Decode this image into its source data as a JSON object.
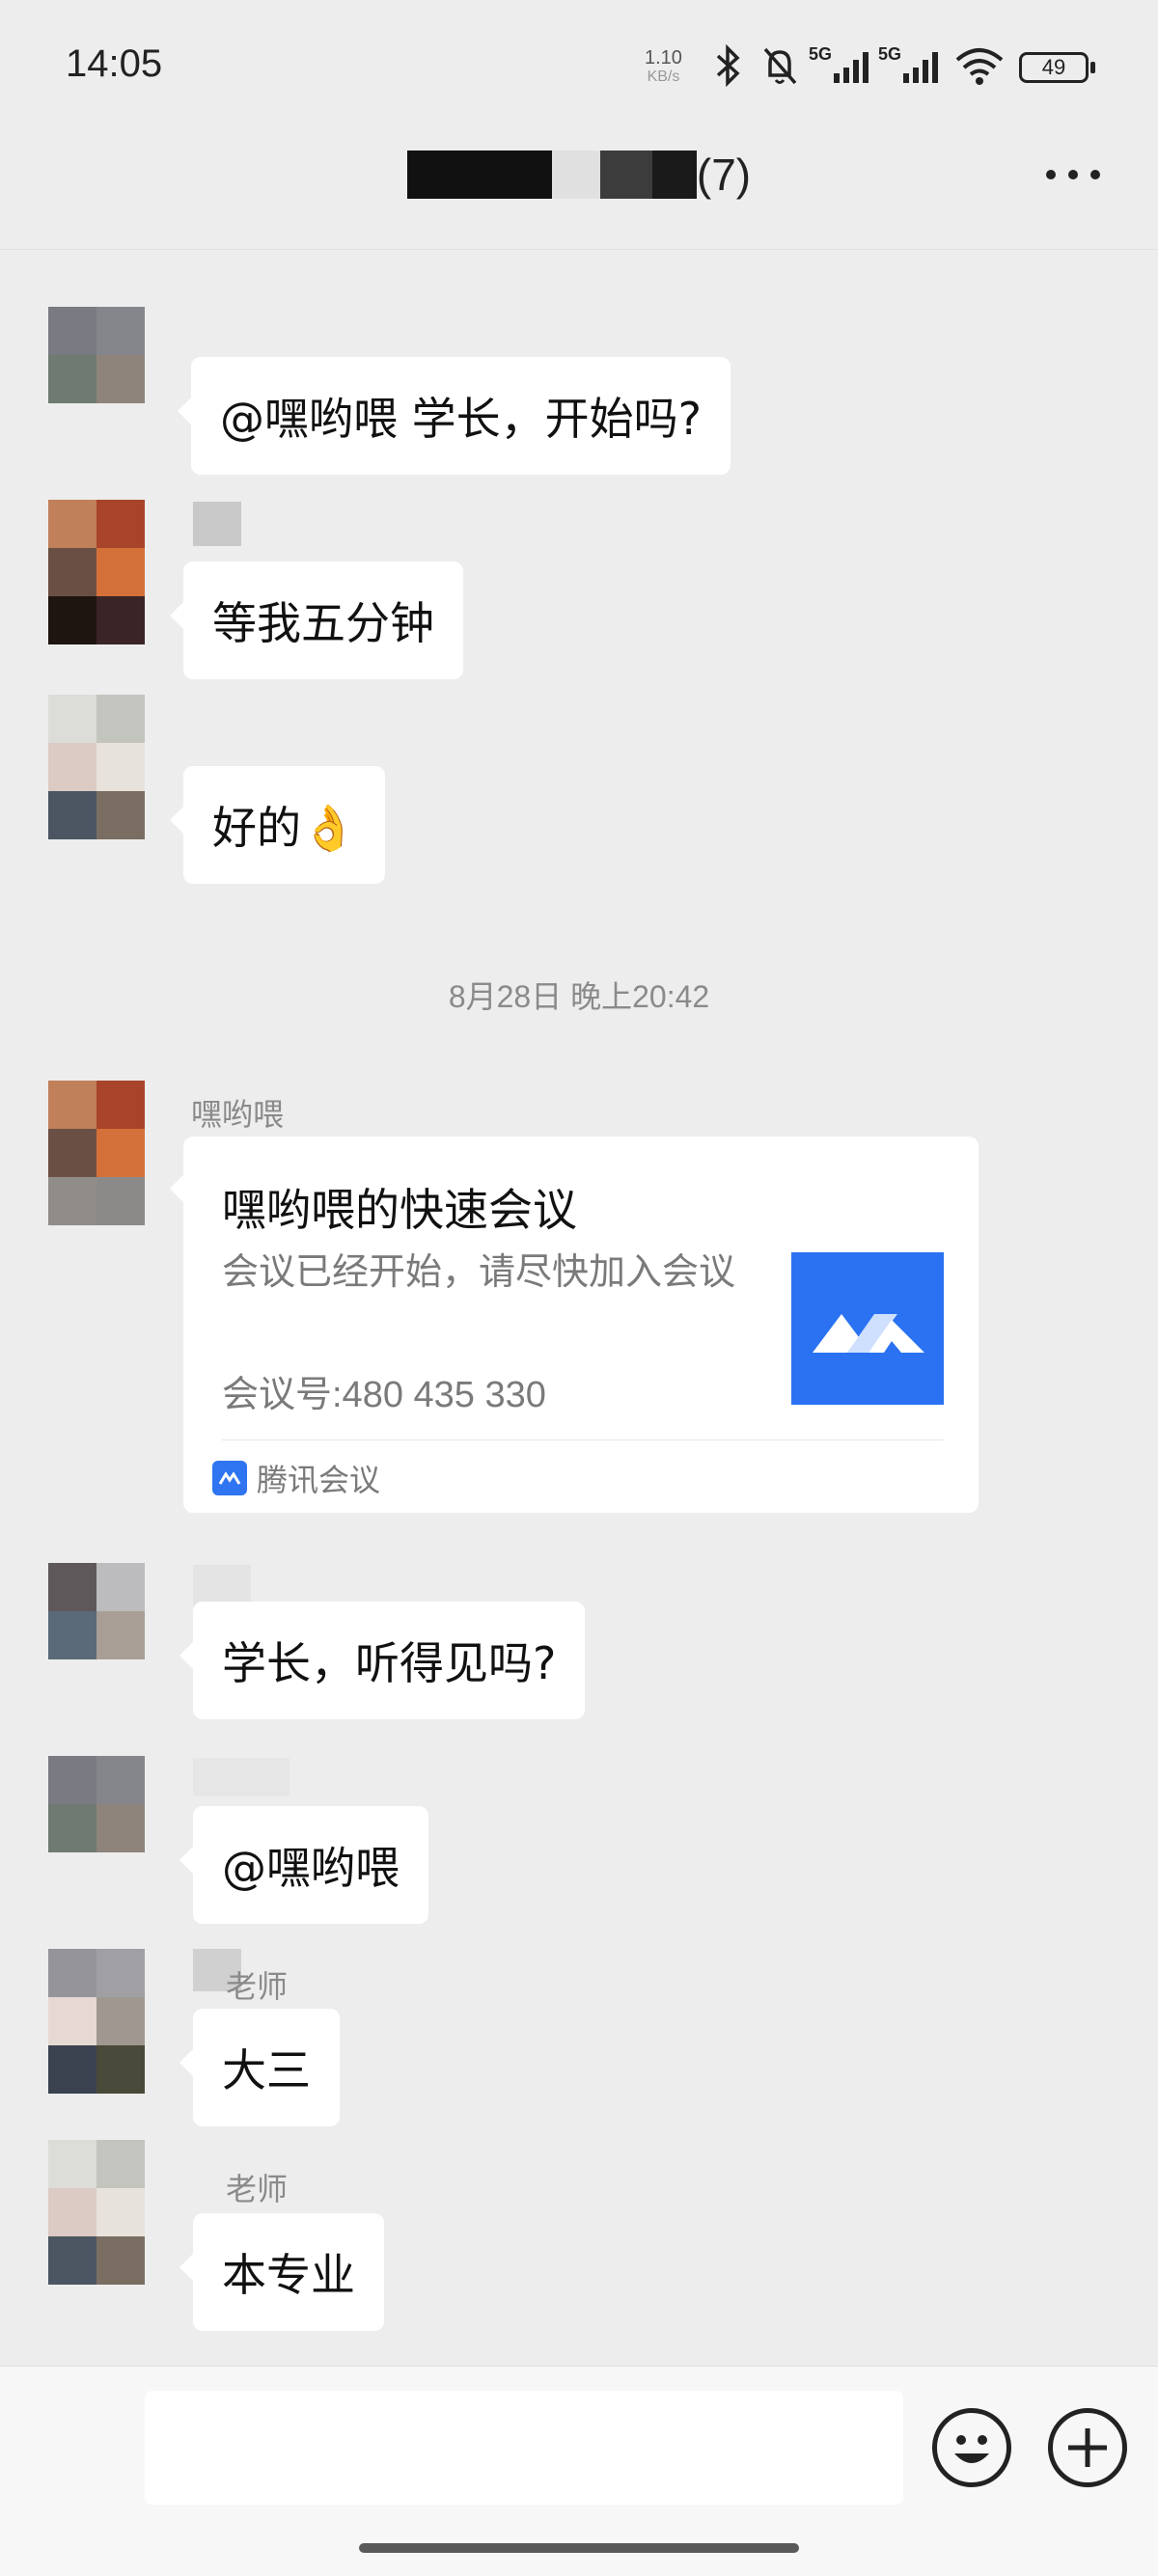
{
  "status_bar": {
    "time": "14:05",
    "speed_value": "1.10",
    "speed_unit": "KB/s",
    "net1": "5G",
    "net2": "5G",
    "battery": "49",
    "icons": [
      "bluetooth-icon",
      "mute-bell-icon",
      "signal-icon",
      "signal-icon",
      "wifi-icon",
      "battery-icon"
    ]
  },
  "header": {
    "title_suffix": "(7)",
    "more_icon": "more-dots-icon"
  },
  "messages": [
    {
      "sender": "",
      "text": "@嘿哟喂  学长，开始吗?"
    },
    {
      "sender": "",
      "text": "等我五分钟"
    },
    {
      "sender": "",
      "text": "好的👌"
    }
  ],
  "time_separator": "8月28日 晚上20:42",
  "card_message": {
    "sender": "嘿哟喂",
    "title": "嘿哟喂的快速会议",
    "desc": "会议已经开始，请尽快加入会议",
    "meeting_no": "会议号:480 435 330",
    "source": "腾讯会议"
  },
  "messages2": [
    {
      "sender": "",
      "text": "学长，听得见吗?"
    },
    {
      "sender": "",
      "text": "@嘿哟喂"
    },
    {
      "sender": "老师",
      "text": "大三"
    },
    {
      "sender": "老师",
      "text": "本专业"
    }
  ],
  "input_bar": {
    "emoji_icon": "emoji-icon",
    "plus_icon": "plus-icon"
  },
  "colors": {
    "background": "#ededed",
    "bubble": "#ffffff",
    "meeting_blue": "#2f74f0"
  }
}
